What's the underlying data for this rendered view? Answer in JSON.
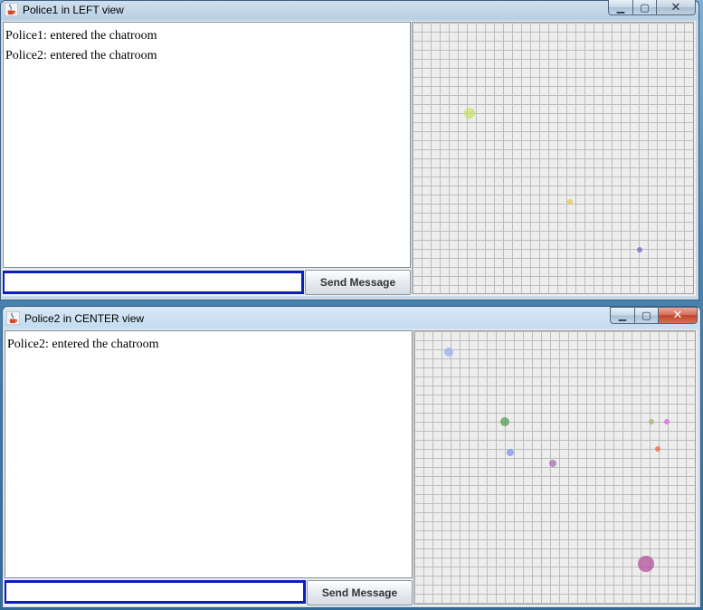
{
  "windows": [
    {
      "title": "Police1 in LEFT view",
      "chat_lines": [
        "Police1: entered the chatroom",
        "Police2: entered the chatroom"
      ],
      "input_value": "",
      "send_label": "Send Message",
      "caption_buttons": {
        "minimize": "▁",
        "maximize": "▢",
        "close": "✕"
      },
      "dots": [
        {
          "color": "#c8e26a"
        },
        {
          "color": "#e8c94a"
        },
        {
          "color": "#6a6ec9"
        }
      ]
    },
    {
      "title": "Police2 in CENTER view",
      "chat_lines": [
        "Police2: entered the chatroom"
      ],
      "input_value": "",
      "send_label": "Send Message",
      "caption_buttons": {
        "minimize": "▁",
        "maximize": "▢",
        "close": "✕"
      },
      "dots": [
        {
          "color": "#9aaef0"
        },
        {
          "color": "#5a9e5a"
        },
        {
          "color": "#7f8ff0"
        },
        {
          "color": "#a56fb6"
        },
        {
          "color": "#9fb86a"
        },
        {
          "color": "#e65ae6"
        },
        {
          "color": "#e66a3a"
        },
        {
          "color": "#b0509a"
        }
      ]
    }
  ],
  "icons": {
    "app": "java-cup-icon"
  }
}
